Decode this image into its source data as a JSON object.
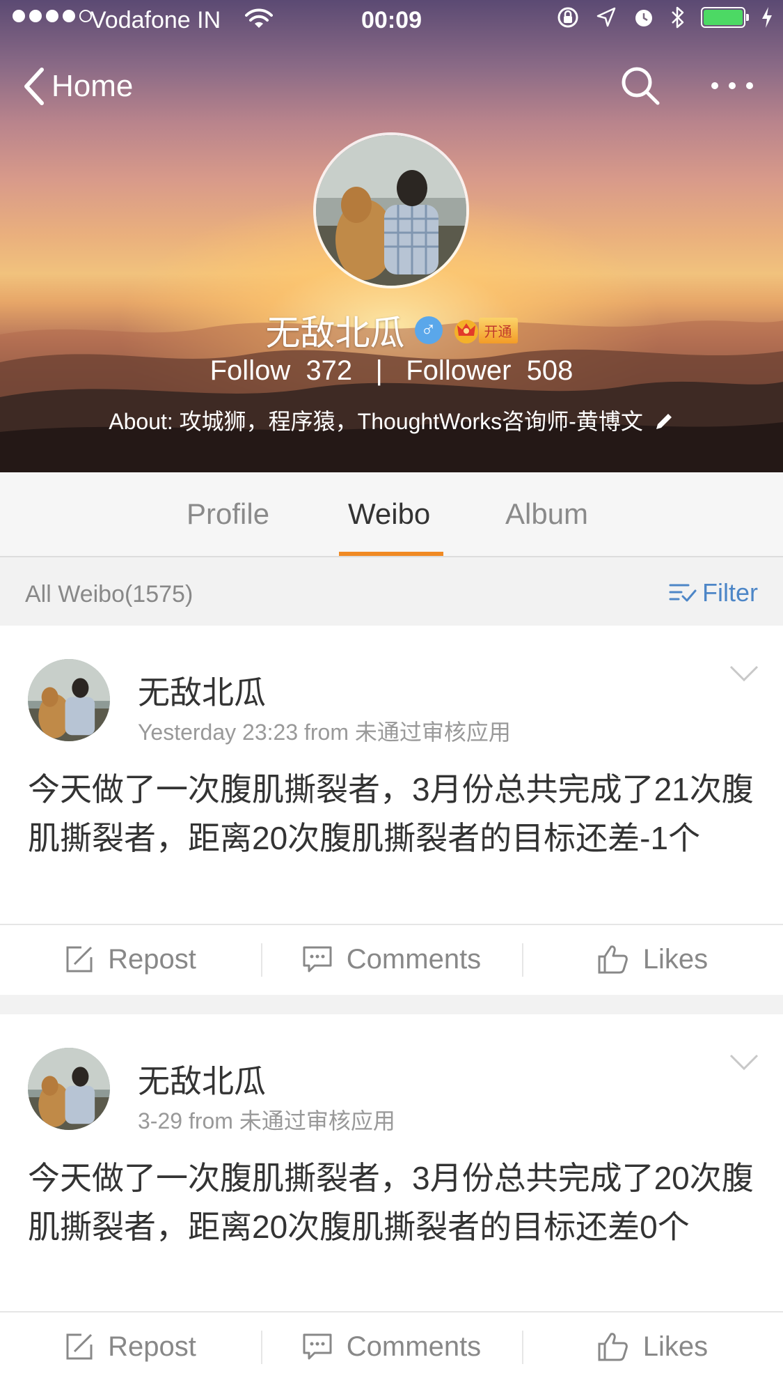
{
  "status_bar": {
    "carrier": "Vodafone IN",
    "time": "00:09"
  },
  "nav": {
    "back_label": "Home"
  },
  "profile": {
    "name": "无敌北瓜",
    "vip_label": "开通",
    "stats_text": "Follow  372   |   Follower  508",
    "about": "About: 攻城狮，程序猿，ThoughtWorks咨询师-黄博文"
  },
  "tabs": [
    {
      "label": "Profile"
    },
    {
      "label": "Weibo"
    },
    {
      "label": "Album"
    }
  ],
  "list": {
    "count_label": "All Weibo(1575)",
    "filter_label": "Filter"
  },
  "posts": [
    {
      "author": "无敌北瓜",
      "meta": "Yesterday 23:23  from 未通过审核应用",
      "body": "今天做了一次腹肌撕裂者，3月份总共完成了21次腹肌撕裂者，距离20次腹肌撕裂者的目标还差-1个",
      "actions": {
        "repost": "Repost",
        "comments": "Comments",
        "likes": "Likes"
      }
    },
    {
      "author": "无敌北瓜",
      "meta": "3-29  from 未通过审核应用",
      "body": "今天做了一次腹肌撕裂者，3月份总共完成了20次腹肌撕裂者，距离20次腹肌撕裂者的目标还差0个",
      "actions": {
        "repost": "Repost",
        "comments": "Comments",
        "likes": "Likes"
      }
    }
  ],
  "colors": {
    "accent": "#f08a24",
    "link": "#4d86c7",
    "battery": "#4cd964",
    "gender": "#5aa7ea"
  },
  "icons": {
    "back": "chevron-left-icon",
    "search": "search-icon",
    "more": "more-dots-icon",
    "gender": "male-icon",
    "vip": "crown-icon",
    "edit": "pencil-icon",
    "filter": "filter-icon",
    "post_menu": "chevron-down-icon",
    "repost": "repost-icon",
    "comments": "comment-icon",
    "likes": "thumbs-up-icon"
  }
}
